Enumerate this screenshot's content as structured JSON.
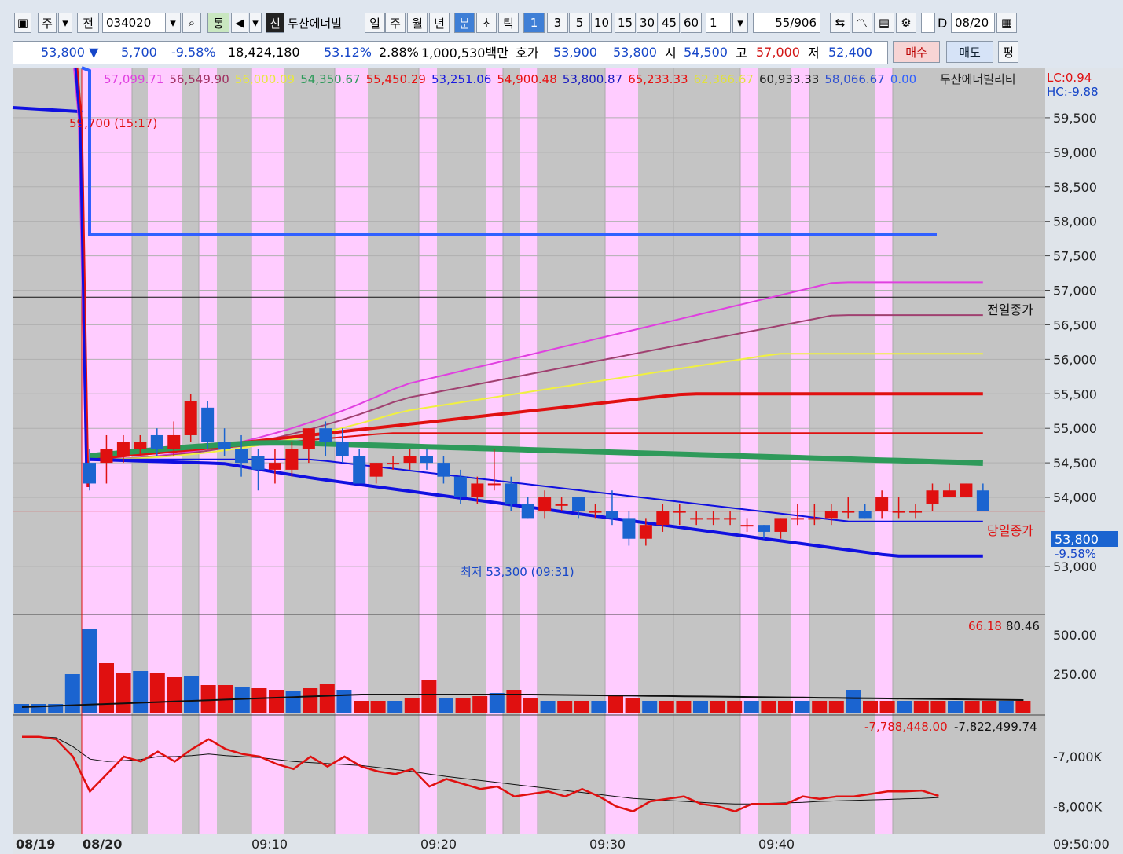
{
  "toolbar": {
    "market_btn": "주",
    "prev_btn": "전",
    "code": "034020",
    "tong": "통",
    "sin": "신",
    "stock_name": "두산에너빌",
    "periods": [
      "일",
      "주",
      "월",
      "년",
      "분",
      "초",
      "틱"
    ],
    "selected_period": "분",
    "intervals": [
      "1",
      "3",
      "5",
      "10",
      "15",
      "30",
      "45",
      "60"
    ],
    "selected_interval": "1",
    "multiplier": "1",
    "count": "55/906",
    "check_label": "D",
    "date": "08/20"
  },
  "quote": {
    "price": "53,800 ▼",
    "change": "5,700",
    "change_pct": "-9.58%",
    "volume": "18,424,180",
    "ratio1": "53.12%",
    "ratio2": "2.88%",
    "amount": "1,000,530백만",
    "bid_label": "호가",
    "ask": "53,900",
    "bid": "53,800",
    "open_label": "시",
    "open": "54,500",
    "high_label": "고",
    "high": "57,000",
    "low_label": "저",
    "low": "52,400",
    "buy": "매수",
    "sell": "매도",
    "eval": "평"
  },
  "chart_data": {
    "type": "candlestick",
    "title": "두산에너빌리티",
    "ma_values": [
      "57,099.71",
      "56,549.90",
      "56,000.09",
      "54,350.67",
      "55,450.29",
      "53,251.06",
      "54,900.48",
      "53,800.87",
      "65,233.33",
      "62,366.67",
      "60,933.33",
      "58,066.67",
      "0.00"
    ],
    "ma_colors": [
      "#e040e0",
      "#a03060",
      "#e8e840",
      "#2e9a5a",
      "#e81010",
      "#1818e0",
      "#e81010",
      "#1818c0",
      "#e81010",
      "#e0e040",
      "#202020",
      "#3050d0",
      "#3060ff"
    ],
    "lc": "LC:0.94",
    "hc": "HC:-9.88",
    "prev_day_label": "59,700 (15:17)",
    "low_label": "최저 53,300 (09:31)",
    "prev_close_label": "전일종가",
    "today_close_label": "당일종가",
    "current_price": "53,800",
    "current_pct": "-9.58%",
    "prev_close": 56900,
    "y_ticks": [
      "59,500",
      "59,000",
      "58,500",
      "58,000",
      "57,500",
      "57,000",
      "56,500",
      "56,000",
      "55,500",
      "55,000",
      "54,500",
      "54,000",
      "53,000"
    ],
    "y_tick_values": [
      59500,
      59000,
      58500,
      58000,
      57500,
      57000,
      56500,
      56000,
      55500,
      55000,
      54500,
      54000,
      53000
    ],
    "ylim": [
      52600,
      60000
    ],
    "x_labels": [
      "08/19",
      "08/20",
      "09:10",
      "09:20",
      "09:30",
      "09:40",
      "09:50:00"
    ],
    "volume_panel": {
      "legend_a": "66.18",
      "legend_b": "80.46",
      "y_ticks": [
        "500.00",
        "250.00"
      ],
      "y_tick_values": [
        500,
        250
      ],
      "ylim": [
        0,
        560
      ],
      "values": [
        60,
        60,
        60,
        250,
        540,
        320,
        260,
        270,
        260,
        230,
        240,
        180,
        180,
        170,
        160,
        150,
        140,
        160,
        190,
        150,
        80,
        80,
        80,
        100,
        210,
        100,
        100,
        110,
        130,
        150,
        100,
        80,
        80,
        80,
        80,
        120,
        100,
        80,
        80,
        80,
        80,
        80,
        80,
        80,
        80,
        80,
        80,
        80,
        80,
        150,
        80,
        80,
        80,
        80,
        80,
        80,
        80,
        80,
        80,
        80
      ]
    },
    "indicator_panel": {
      "legend_a": "-7,788,448.00",
      "legend_b": "-7,822,499.74",
      "y_ticks": [
        "-7,000K",
        "-8,000K"
      ],
      "y_tick_values": [
        -7000,
        -8000
      ],
      "ylim": [
        -8500,
        -6400
      ],
      "red": [
        -6600,
        -6600,
        -6650,
        -7000,
        -7700,
        -7350,
        -7000,
        -7100,
        -6900,
        -7100,
        -6850,
        -6650,
        -6850,
        -6950,
        -7000,
        -7150,
        -7250,
        -7000,
        -7200,
        -7000,
        -7200,
        -7300,
        -7350,
        -7250,
        -7600,
        -7450,
        -7550,
        -7650,
        -7600,
        -7800,
        -7750,
        -7700,
        -7800,
        -7650,
        -7800,
        -8000,
        -8100,
        -7900,
        -7850,
        -7800,
        -7950,
        -8000,
        -8100,
        -7950,
        -7950,
        -7950,
        -7800,
        -7850,
        -7800,
        -7800,
        -7750,
        -7700,
        -7700,
        -7680,
        -7790
      ],
      "black": [
        -6600,
        -6600,
        -6620,
        -6800,
        -7050,
        -7100,
        -7080,
        -7060,
        -7000,
        -7000,
        -6980,
        -6950,
        -6980,
        -7000,
        -7020,
        -7060,
        -7100,
        -7120,
        -7140,
        -7160,
        -7180,
        -7220,
        -7260,
        -7300,
        -7350,
        -7400,
        -7440,
        -7480,
        -7520,
        -7560,
        -7600,
        -7640,
        -7680,
        -7720,
        -7760,
        -7800,
        -7840,
        -7860,
        -7880,
        -7900,
        -7920,
        -7940,
        -7950,
        -7950,
        -7940,
        -7930,
        -7920,
        -7900,
        -7890,
        -7880,
        -7870,
        -7860,
        -7850,
        -7840,
        -7822
      ]
    },
    "candles": [
      {
        "o": 54500,
        "c": 54200,
        "h": 54700,
        "l": 54100
      },
      {
        "o": 54500,
        "c": 54700,
        "h": 54900,
        "l": 54200
      },
      {
        "o": 54600,
        "c": 54800,
        "h": 54900,
        "l": 54500
      },
      {
        "o": 54700,
        "c": 54800,
        "h": 54900,
        "l": 54600
      },
      {
        "o": 54900,
        "c": 54700,
        "h": 55000,
        "l": 54600
      },
      {
        "o": 54700,
        "c": 54900,
        "h": 55100,
        "l": 54600
      },
      {
        "o": 54900,
        "c": 55400,
        "h": 55500,
        "l": 54800
      },
      {
        "o": 55300,
        "c": 54800,
        "h": 55400,
        "l": 54700
      },
      {
        "o": 54800,
        "c": 54700,
        "h": 55000,
        "l": 54600
      },
      {
        "o": 54700,
        "c": 54500,
        "h": 54900,
        "l": 54300
      },
      {
        "o": 54600,
        "c": 54400,
        "h": 54700,
        "l": 54100
      },
      {
        "o": 54400,
        "c": 54500,
        "h": 54700,
        "l": 54200
      },
      {
        "o": 54400,
        "c": 54700,
        "h": 54800,
        "l": 54300
      },
      {
        "o": 54700,
        "c": 55000,
        "h": 55000,
        "l": 54500
      },
      {
        "o": 55000,
        "c": 54800,
        "h": 55100,
        "l": 54600
      },
      {
        "o": 54800,
        "c": 54600,
        "h": 55000,
        "l": 54500
      },
      {
        "o": 54600,
        "c": 54200,
        "h": 54700,
        "l": 54200
      },
      {
        "o": 54300,
        "c": 54500,
        "h": 54500,
        "l": 54200
      },
      {
        "o": 54500,
        "c": 54500,
        "h": 54600,
        "l": 54400
      },
      {
        "o": 54500,
        "c": 54600,
        "h": 54700,
        "l": 54400
      },
      {
        "o": 54600,
        "c": 54500,
        "h": 54700,
        "l": 54400
      },
      {
        "o": 54500,
        "c": 54300,
        "h": 54600,
        "l": 54200
      },
      {
        "o": 54300,
        "c": 54000,
        "h": 54400,
        "l": 53900
      },
      {
        "o": 54000,
        "c": 54200,
        "h": 54300,
        "l": 53900
      },
      {
        "o": 54200,
        "c": 54200,
        "h": 54700,
        "l": 54100
      },
      {
        "o": 54200,
        "c": 53900,
        "h": 54300,
        "l": 53800
      },
      {
        "o": 53900,
        "c": 53700,
        "h": 54000,
        "l": 53700
      },
      {
        "o": 53800,
        "c": 54000,
        "h": 54100,
        "l": 53700
      },
      {
        "o": 53900,
        "c": 53900,
        "h": 54000,
        "l": 53800
      },
      {
        "o": 54000,
        "c": 53800,
        "h": 54000,
        "l": 53700
      },
      {
        "o": 53800,
        "c": 53800,
        "h": 53900,
        "l": 53700
      },
      {
        "o": 53800,
        "c": 53700,
        "h": 54100,
        "l": 53600
      },
      {
        "o": 53700,
        "c": 53400,
        "h": 53800,
        "l": 53300
      },
      {
        "o": 53400,
        "c": 53600,
        "h": 53700,
        "l": 53300
      },
      {
        "o": 53600,
        "c": 53800,
        "h": 53900,
        "l": 53500
      },
      {
        "o": 53800,
        "c": 53800,
        "h": 53900,
        "l": 53600
      },
      {
        "o": 53700,
        "c": 53700,
        "h": 53800,
        "l": 53600
      },
      {
        "o": 53700,
        "c": 53700,
        "h": 53800,
        "l": 53600
      },
      {
        "o": 53700,
        "c": 53700,
        "h": 53800,
        "l": 53600
      },
      {
        "o": 53600,
        "c": 53600,
        "h": 53700,
        "l": 53500
      },
      {
        "o": 53600,
        "c": 53500,
        "h": 53600,
        "l": 53400
      },
      {
        "o": 53500,
        "c": 53700,
        "h": 53700,
        "l": 53400
      },
      {
        "o": 53700,
        "c": 53700,
        "h": 53900,
        "l": 53600
      },
      {
        "o": 53700,
        "c": 53700,
        "h": 53900,
        "l": 53600
      },
      {
        "o": 53700,
        "c": 53800,
        "h": 53900,
        "l": 53600
      },
      {
        "o": 53800,
        "c": 53800,
        "h": 54000,
        "l": 53700
      },
      {
        "o": 53800,
        "c": 53700,
        "h": 53900,
        "l": 53700
      },
      {
        "o": 53800,
        "c": 54000,
        "h": 54100,
        "l": 53700
      },
      {
        "o": 53800,
        "c": 53800,
        "h": 54000,
        "l": 53700
      },
      {
        "o": 53800,
        "c": 53800,
        "h": 53900,
        "l": 53700
      },
      {
        "o": 53900,
        "c": 54100,
        "h": 54200,
        "l": 53800
      },
      {
        "o": 54000,
        "c": 54100,
        "h": 54200,
        "l": 54000
      },
      {
        "o": 54000,
        "c": 54200,
        "h": 54200,
        "l": 54000
      },
      {
        "o": 54100,
        "c": 53800,
        "h": 54200,
        "l": 53800
      }
    ]
  }
}
